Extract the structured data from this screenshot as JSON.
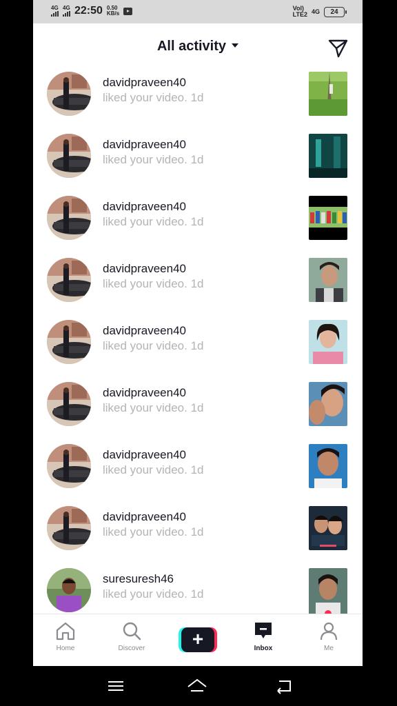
{
  "status_bar": {
    "net1": "4G",
    "net2": "4G",
    "time": "22:50",
    "speed_value": "0.50",
    "speed_unit": "KB/s",
    "volte_top": "Vol)",
    "volte_bottom": "LTE2",
    "net3": "4G",
    "battery": "24"
  },
  "header": {
    "title": "All activity"
  },
  "notifications": [
    {
      "username": "davidpraveen40",
      "action": "liked your video. 1d"
    },
    {
      "username": "davidpraveen40",
      "action": "liked your video. 1d"
    },
    {
      "username": "davidpraveen40",
      "action": "liked your video. 1d"
    },
    {
      "username": "davidpraveen40",
      "action": "liked your video. 1d"
    },
    {
      "username": "davidpraveen40",
      "action": "liked your video. 1d"
    },
    {
      "username": "davidpraveen40",
      "action": "liked your video. 1d"
    },
    {
      "username": "davidpraveen40",
      "action": "liked your video. 1d"
    },
    {
      "username": "davidpraveen40",
      "action": "liked your video. 1d"
    },
    {
      "username": "suresuresh46",
      "action": "liked your video. 1d"
    }
  ],
  "tabbar": {
    "home": "Home",
    "discover": "Discover",
    "inbox": "Inbox",
    "me": "Me",
    "active": "inbox"
  },
  "colors": {
    "accent_cyan": "#25f4ee",
    "accent_red": "#fe2c55",
    "text_primary": "#161823",
    "text_secondary": "#b3b3b8"
  }
}
